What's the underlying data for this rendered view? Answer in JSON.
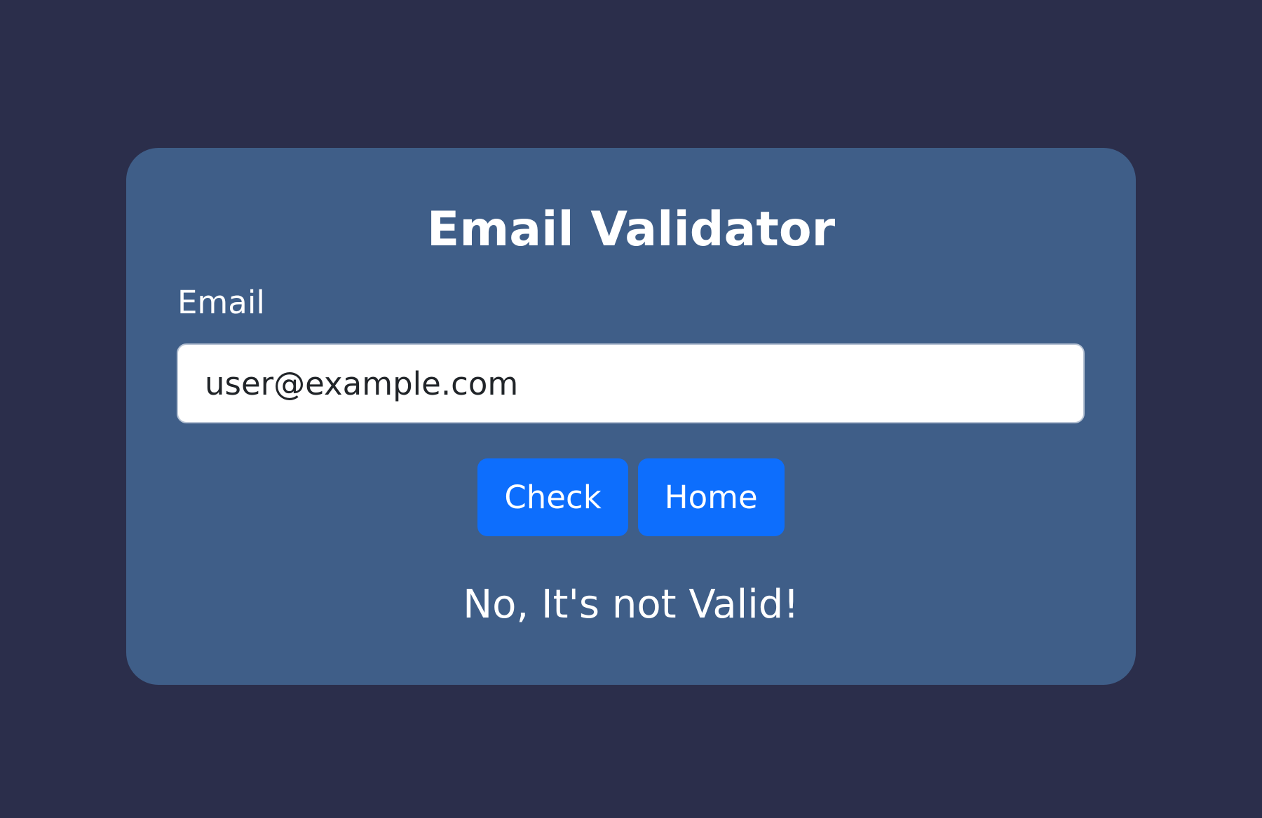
{
  "page": {
    "background_color": "#2b2e4b",
    "card_color": "#3f5e88",
    "accent_color": "#0d6efd"
  },
  "validator": {
    "title": "Email Validator",
    "email_label": "Email",
    "email_value": "user@example.com",
    "check_label": "Check",
    "home_label": "Home",
    "result_text": "No, It's not Valid!"
  }
}
